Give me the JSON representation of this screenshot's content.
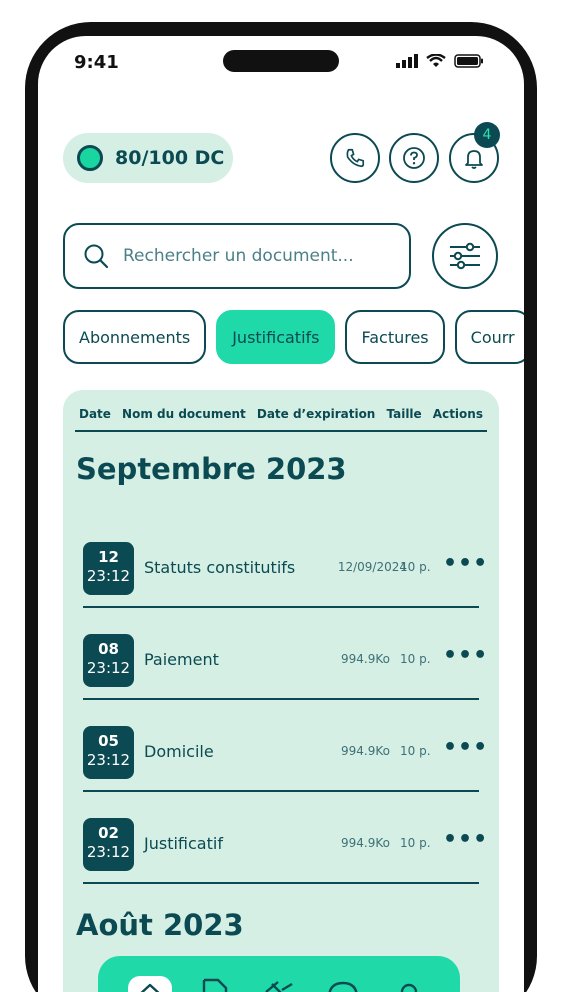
{
  "status_bar": {
    "time": "9:41"
  },
  "header": {
    "score_label": "80/100 DC",
    "notification_count": "4",
    "icons": [
      "phone-icon",
      "help-icon",
      "bell-icon"
    ]
  },
  "search": {
    "placeholder": "Rechercher un document..."
  },
  "tabs": [
    {
      "label": "Abonnements",
      "active": false
    },
    {
      "label": "Justificatifs",
      "active": true
    },
    {
      "label": "Factures",
      "active": false
    },
    {
      "label": "Courr",
      "active": false
    }
  ],
  "table": {
    "columns": [
      "Date",
      "Nom du document",
      "Date d’expiration",
      "Taille",
      "Actions"
    ]
  },
  "sections": [
    {
      "month": "Septembre 2023",
      "documents": [
        {
          "day": "12",
          "time": "23:12",
          "name": "Statuts constitutifs",
          "meta": "12/09/2024",
          "pages": "10 p.",
          "actions": "•••"
        },
        {
          "day": "08",
          "time": "23:12",
          "name": "Paiement",
          "meta": "994.9Ko",
          "pages": "10 p.",
          "actions": "•••"
        },
        {
          "day": "05",
          "time": "23:12",
          "name": "Domicile",
          "meta": "994.9Ko",
          "pages": "10 p.",
          "actions": "•••"
        },
        {
          "day": "02",
          "time": "23:12",
          "name": "Justificatif",
          "meta": "994.9Ko",
          "pages": "10 p.",
          "actions": "•••"
        }
      ]
    },
    {
      "month": "Août 2023",
      "documents": []
    }
  ],
  "colors": {
    "primary": "#0b4a52",
    "accent": "#1fd9a8",
    "panel": "#d5efe4"
  }
}
